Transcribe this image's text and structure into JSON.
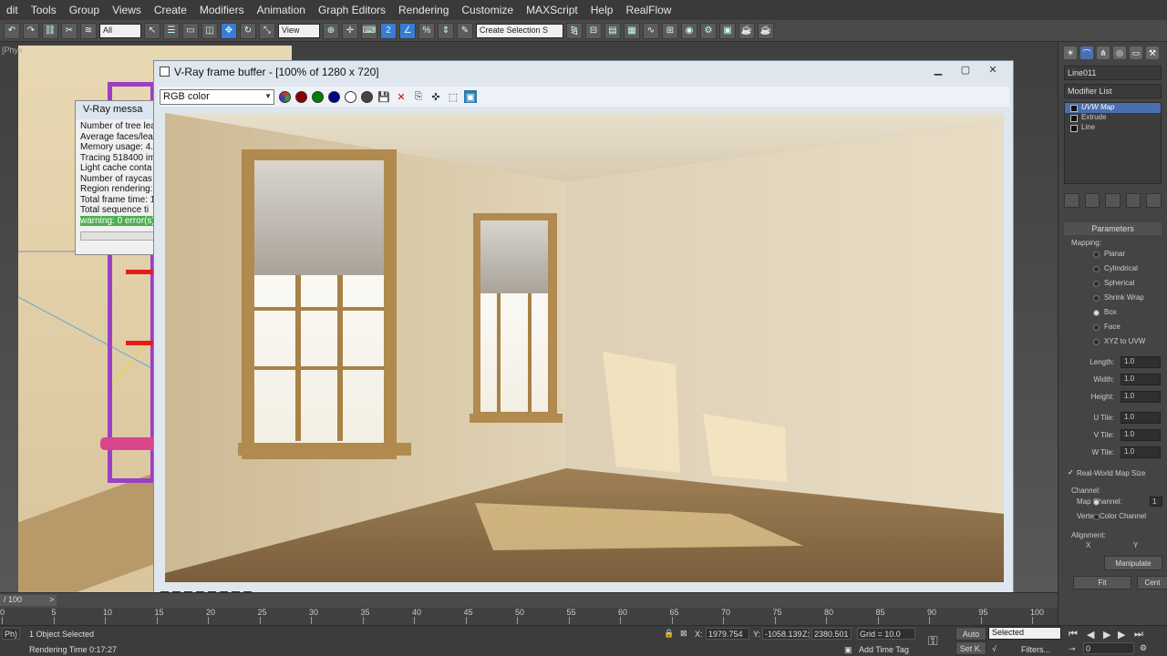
{
  "menubar": [
    "dit",
    "Tools",
    "Group",
    "Views",
    "Create",
    "Modifiers",
    "Animation",
    "Graph Editors",
    "Rendering",
    "Customize",
    "MAXScript",
    "Help",
    "RealFlow"
  ],
  "toolbar": {
    "filter_value": "All",
    "ref_coord_value": "View",
    "selection_set_placeholder": "Create Selection S"
  },
  "viewport": {
    "label": "[Phys"
  },
  "vray_messages": {
    "title": "V-Ray messa",
    "lines": [
      "Number of tree lea",
      "Average faces/lea",
      "Memory usage: 4.",
      "Tracing 518400 im",
      "Light cache conta",
      "Number of raycas",
      "Region rendering:",
      "Total frame time: 1",
      "Total sequence ti"
    ],
    "warning": "warning: 0 error(s),"
  },
  "vray_fb": {
    "title": "V-Ray frame buffer - [100% of 1280 x 720]",
    "channel": "RGB color",
    "color_dots": [
      "#4a4a7a",
      "#8b0000",
      "#008000",
      "#00008b",
      "#ffffff",
      "#444444"
    ]
  },
  "right_panel": {
    "object_name": "Line011",
    "modifier_list_label": "Modifier List",
    "stack": [
      "UVW Map",
      "Extrude",
      "Line"
    ],
    "parameters_title": "Parameters",
    "mapping_label": "Mapping:",
    "mapping_options": [
      "Planar",
      "Cylindrical",
      "Spherical",
      "Shrink Wrap",
      "Box",
      "Face",
      "XYZ to UVW"
    ],
    "selected_mapping": "Box",
    "length_label": "Length:",
    "width_label": "Width:",
    "height_label": "Height:",
    "length": "1.0",
    "width": "1.0",
    "height": "1.0",
    "u_tile_label": "U Tile:",
    "v_tile_label": "V Tile:",
    "w_tile_label": "W Tile:",
    "u_tile": "1.0",
    "v_tile": "1.0",
    "w_tile": "1.0",
    "real_world_label": "Real-World Map Size",
    "channel_label": "Channel:",
    "map_channel_label": "Map Channel:",
    "map_channel_value": "1",
    "vertex_color_label": "Vertex Color Channel",
    "alignment_label": "Alignment:",
    "x_label": "X",
    "y_label": "Y",
    "manipulate_label": "Manipulate",
    "fit_label": "Fit",
    "center_label": "Cent"
  },
  "timeline": {
    "slider_text": "/ 100",
    "ticks": [
      "0",
      "5",
      "10",
      "15",
      "20",
      "25",
      "30",
      "35",
      "40",
      "45",
      "50",
      "55",
      "60",
      "65",
      "70",
      "75",
      "80",
      "85",
      "90",
      "95",
      "100"
    ]
  },
  "status": {
    "selection": "1 Object Selected",
    "render_time": "Rendering Time  0:17:27",
    "ph_label": "Ph)",
    "x_label": "X:",
    "y_label": "Y:",
    "z_label": "Z:",
    "x": "1979.754",
    "y": "-1058.139",
    "z": "2380.501",
    "grid": "Grid = 10.0",
    "add_time_tag": "Add Time Tag",
    "auto_label": "Auto",
    "setk_label": "Set K.",
    "selected_value": "Selected",
    "filters_label": "Filters...",
    "frame_value": "0"
  }
}
